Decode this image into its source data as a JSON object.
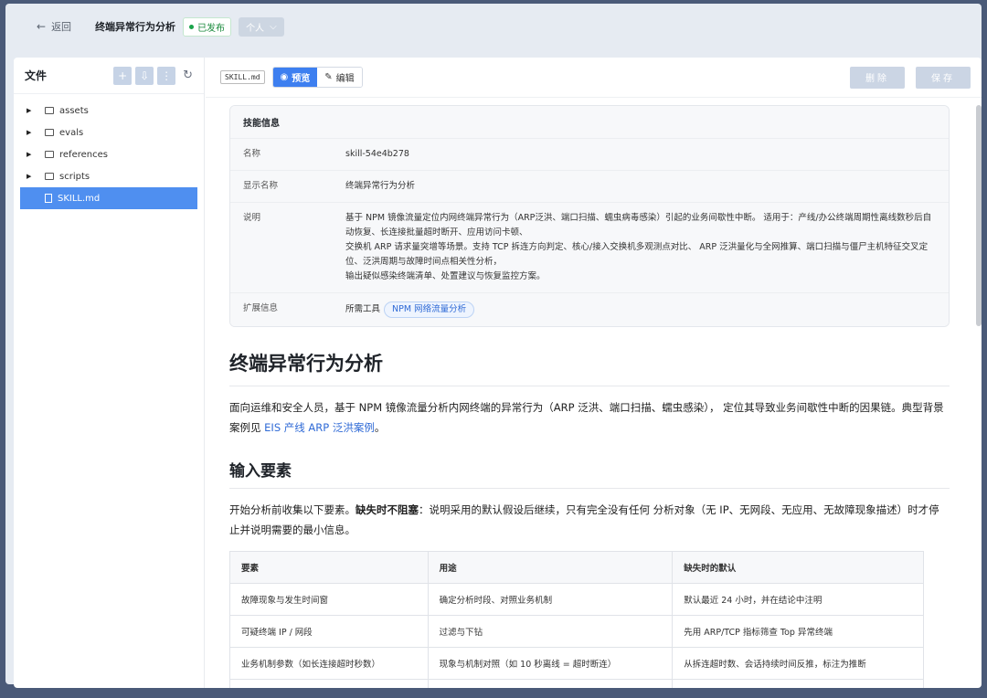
{
  "topbar": {
    "back_label": "返回",
    "title": "终端异常行为分析",
    "status": "已发布",
    "scope": "个人"
  },
  "sidebar": {
    "title": "文件",
    "items": [
      {
        "label": "assets",
        "type": "folder"
      },
      {
        "label": "evals",
        "type": "folder"
      },
      {
        "label": "references",
        "type": "folder"
      },
      {
        "label": "scripts",
        "type": "folder"
      },
      {
        "label": "SKILL.md",
        "type": "file",
        "selected": true
      }
    ]
  },
  "editor": {
    "filename": "SKILL.md",
    "preview_label": "预览",
    "edit_label": "编辑",
    "delete_label": "删除",
    "save_label": "保存"
  },
  "info": {
    "header": "技能信息",
    "rows": [
      {
        "key": "名称",
        "value": "skill-54e4b278"
      },
      {
        "key": "显示名称",
        "value": "终端异常行为分析"
      },
      {
        "key": "说明",
        "value": [
          "基于 NPM 镜像流量定位内网终端异常行为（ARP泛洪、端口扫描、蠕虫病毒感染）引起的业务间歇性中断。 适用于：产线/办公终端周期性离线数秒后自动恢复、长连接批量超时断开、应用访问卡顿、",
          "交换机 ARP 请求量突增等场景。支持 TCP 拆连方向判定、核心/接入交换机多观测点对比、 ARP 泛洪量化与全网推算、端口扫描与僵尸主机特征交叉定位、泛洪周期与故障时间点相关性分析，",
          "输出疑似感染终端清单、处置建议与恢复监控方案。"
        ]
      },
      {
        "key": "扩展信息",
        "value_prefix": "所需工具",
        "tag": "NPM 网络流量分析"
      }
    ]
  },
  "doc": {
    "h1": "终端异常行为分析",
    "p1": "面向运维和安全人员，基于 NPM 镜像流量分析内网终端的异常行为（ARP 泛洪、端口扫描、蠕虫感染）， 定位其导致业务间歇性中断的因果链。典型背景案例见 ",
    "p1_link": "EIS 产线 ARP 泛洪案例",
    "p1_end": "。",
    "h2": "输入要素",
    "p2_a": "开始分析前收集以下要素。",
    "p2_b": "缺失时不阻塞",
    "p2_c": "：说明采用的默认假设后继续，只有完全没有任何 分析对象（无 IP、无网段、无应用、无故障现象描述）时才停止并说明需要的最小信息。",
    "table": {
      "headers": [
        "要素",
        "用途",
        "缺失时的默认"
      ],
      "rows": [
        [
          "故障现象与发生时间窗",
          "确定分析时段、对照业务机制",
          "默认最近 24 小时，并在结论中注明"
        ],
        [
          "可疑终端 IP / 网段",
          "过滤与下钻",
          "先用 ARP/TCP 指标筛查 Top 异常终端"
        ],
        [
          "业务机制参数（如长连接超时秒数）",
          "现象与机制对照（如 10 秒离线 = 超时断连）",
          "从拆连超时数、会话持续时间反推，标注为推断"
        ],
        [
          "",
          "",
          ""
        ]
      ]
    }
  }
}
